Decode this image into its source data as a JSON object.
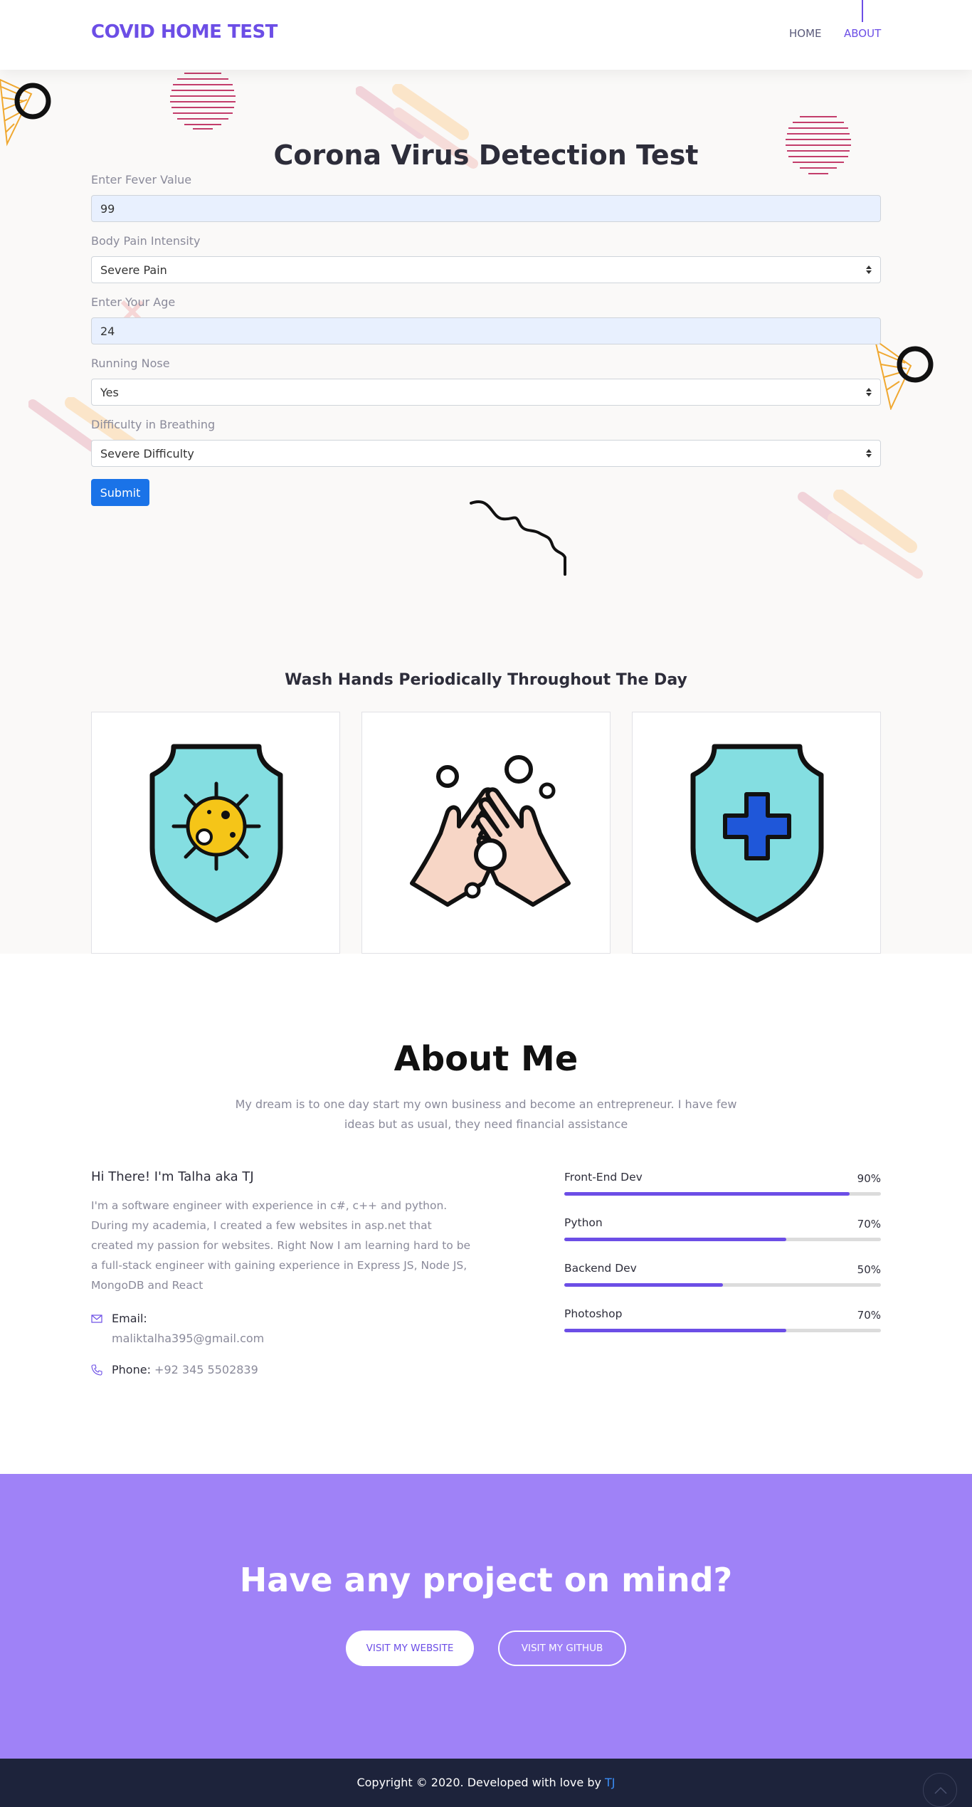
{
  "nav": {
    "brand": "COVID HOME TEST",
    "links": [
      {
        "label": "HOME",
        "active": false
      },
      {
        "label": "ABOUT",
        "active": true
      }
    ],
    "accent": "#6c4ee6"
  },
  "hero": {
    "title": "Corona Virus Detection Test",
    "background": "#faf9f8",
    "form": {
      "fever": {
        "label": "Enter Fever Value",
        "value": "99"
      },
      "body_pain": {
        "label": "Body Pain Intensity",
        "value": "Severe Pain"
      },
      "age": {
        "label": "Enter Your Age",
        "value": "24"
      },
      "running_nose": {
        "label": "Running Nose",
        "value": "Yes"
      },
      "breathing": {
        "label": "Difficulty in Breathing",
        "value": "Severe Difficulty"
      },
      "submit_label": "Submit"
    }
  },
  "wash": {
    "title": "Wash Hands Periodically Throughout The Day",
    "cards": [
      {
        "icon": "virus-shield-icon"
      },
      {
        "icon": "washing-hands-icon"
      },
      {
        "icon": "medical-shield-icon"
      }
    ]
  },
  "about": {
    "title": "About Me",
    "subtitle": "My dream is to one day start my own business and become an entrepreneur. I have few ideas but as usual, they need financial assistance",
    "intro_name": "Hi There! I'm Talha aka TJ",
    "intro_text": "I'm a software engineer with experience in c#, c++ and python. During my academia, I created a few websites in asp.net that created my passion for websites. Right Now I am learning hard to be a full-stack engineer with gaining experience in Express JS, Node JS, MongoDB and React",
    "email_label": "Email:",
    "email_value": "maliktalha395@gmail.com",
    "phone_label": "Phone:",
    "phone_value": "+92 345 5502839",
    "skills": [
      {
        "name": "Front-End Dev",
        "percent": "90%",
        "value": 90
      },
      {
        "name": "Python",
        "percent": "70%",
        "value": 70
      },
      {
        "name": "Backend Dev",
        "percent": "50%",
        "value": 50
      },
      {
        "name": "Photoshop",
        "percent": "70%",
        "value": 70
      }
    ]
  },
  "cta": {
    "title": "Have any project on mind?",
    "primary_label": "VISIT MY WEBSITE",
    "secondary_label": "VISIT MY GITHUB",
    "background": "#9f82f7"
  },
  "footer": {
    "copyright": "Copyright © 2020. Developed with love by",
    "author": "TJ",
    "background": "#1d233b"
  }
}
